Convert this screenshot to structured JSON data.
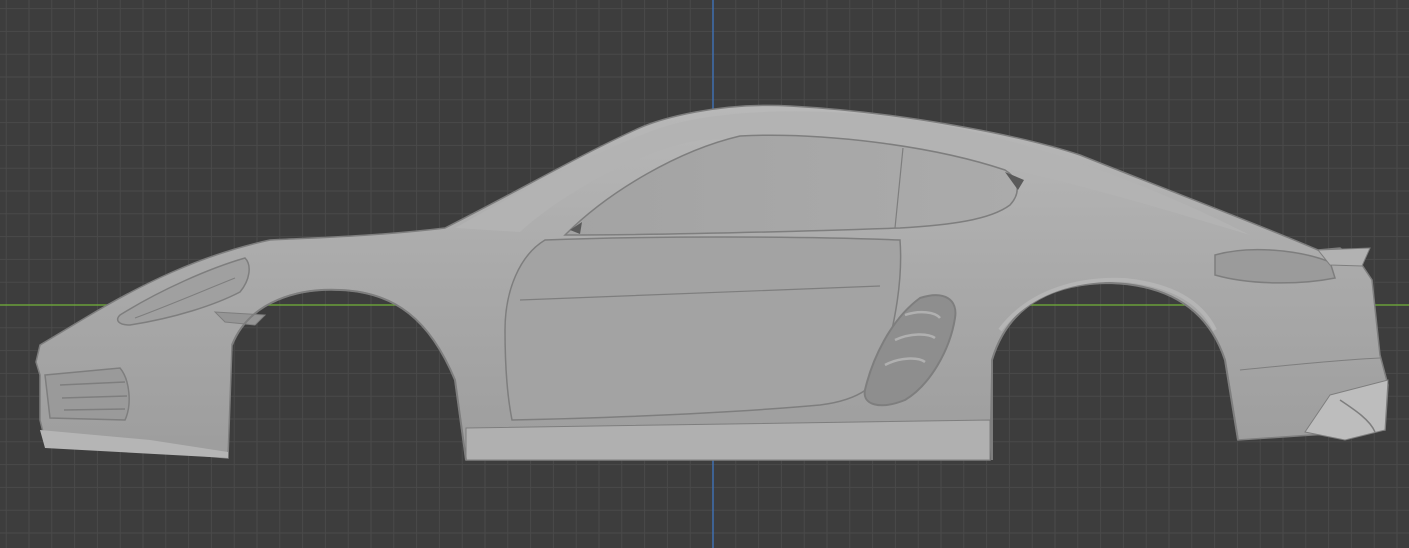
{
  "viewport": {
    "background": "#3d3d3d",
    "grid_minor": "#4a4a4a",
    "grid_major": "#555555",
    "x_axis_color": "#6a9f3a",
    "z_axis_color": "#3f6fb0"
  },
  "model": {
    "body_color": "#a6a6a6",
    "shade_color": "#9c9c9c",
    "highlight_color": "#b4b4b4",
    "edge_color": "#7e7e7e",
    "dark_detail_color": "#5a5a5a"
  }
}
